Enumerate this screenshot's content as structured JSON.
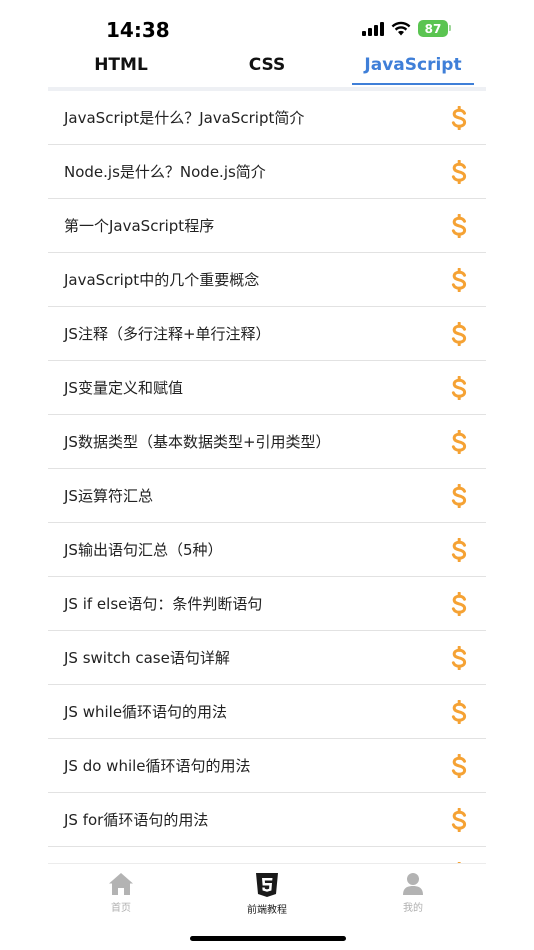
{
  "status": {
    "time": "14:38",
    "battery": "87"
  },
  "tabs": [
    {
      "label": "HTML",
      "active": false
    },
    {
      "label": "CSS",
      "active": false
    },
    {
      "label": "JavaScript",
      "active": true
    }
  ],
  "list": {
    "items": [
      "JavaScript是什么？JavaScript简介",
      "Node.js是什么？Node.js简介",
      "第一个JavaScript程序",
      "JavaScript中的几个重要概念",
      "JS注释（多行注释+单行注释）",
      "JS变量定义和赋值",
      "JS数据类型（基本数据类型+引用类型）",
      "JS运算符汇总",
      "JS输出语句汇总（5种）",
      "JS if else语句：条件判断语句",
      "JS switch case语句详解",
      "JS while循环语句的用法",
      "JS do while循环语句的用法",
      "JS for循环语句的用法",
      ""
    ],
    "item_icon": "dollar-icon",
    "icon_color": "#f5a234"
  },
  "bottom_nav": [
    {
      "label": "首页",
      "icon": "home-icon",
      "active": false
    },
    {
      "label": "前端教程",
      "icon": "html5-icon",
      "active": true
    },
    {
      "label": "我的",
      "icon": "user-icon",
      "active": false
    }
  ],
  "colors": {
    "accent": "#3f7fd8",
    "icon": "#f5a234"
  }
}
